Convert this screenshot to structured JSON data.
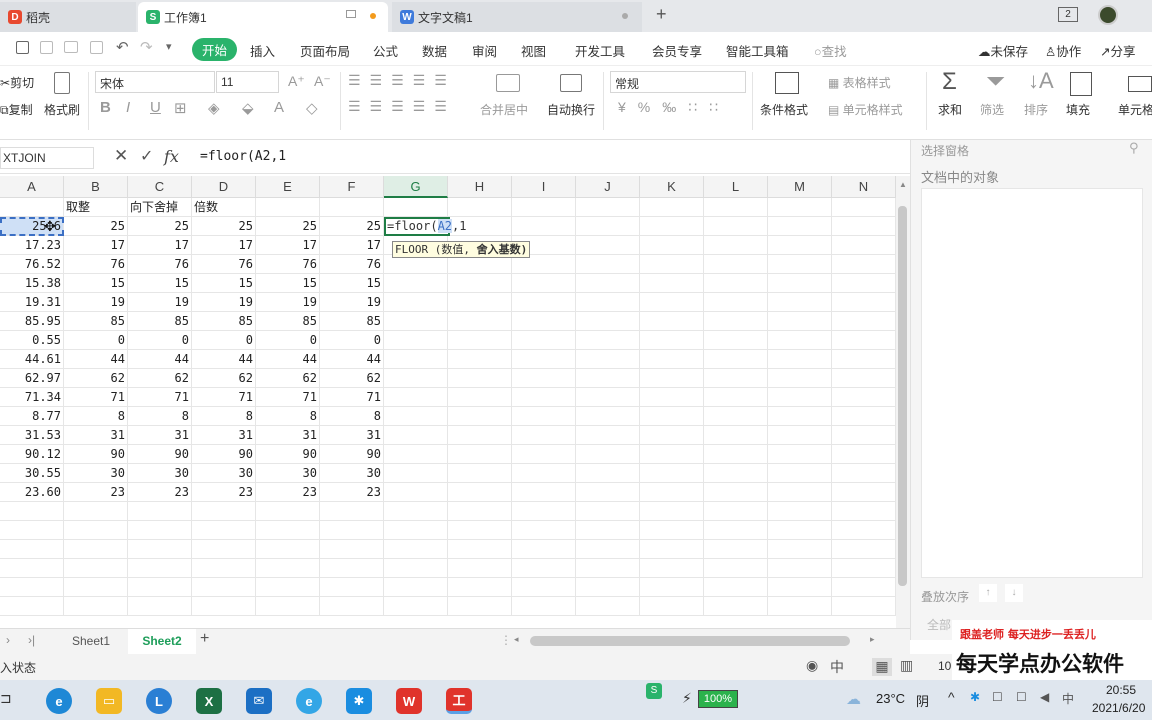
{
  "tabs": [
    {
      "label": "稻壳"
    },
    {
      "label": "工作簿1"
    },
    {
      "label": "文字文稿1"
    }
  ],
  "window": {
    "page_count": "2"
  },
  "menu": {
    "items": [
      "开始",
      "插入",
      "页面布局",
      "公式",
      "数据",
      "审阅",
      "视图",
      "开发工具",
      "会员专享",
      "智能工具箱"
    ],
    "search": "查找",
    "unsaved": "未保存",
    "collab": "协作",
    "share": "分享"
  },
  "ribbon": {
    "cut": "剪切",
    "format_painter": "格式刷",
    "copy": "复制",
    "font_name": "宋体",
    "font_size": "11",
    "merge": "合并居中",
    "wrap": "自动换行",
    "number_format": "常规",
    "cond_format": "条件格式",
    "table_style": "表格样式",
    "cell_style": "单元格样式",
    "sum": "求和",
    "filter": "筛选",
    "sort": "排序",
    "fill": "填充",
    "cell": "单元格"
  },
  "formula_bar": {
    "name_box": "XTJOIN",
    "fx": "fx",
    "formula": "=floor(A2,1"
  },
  "grid": {
    "columns": [
      "A",
      "B",
      "C",
      "D",
      "E",
      "F",
      "G",
      "H",
      "I",
      "J",
      "K",
      "L",
      "M",
      "N"
    ],
    "header_row": [
      "",
      "取整",
      "向下舍掉",
      "倍数",
      "",
      "",
      "",
      "",
      "",
      "",
      "",
      "",
      "",
      ""
    ],
    "rows": [
      [
        "25.6",
        "25",
        "25",
        "25",
        "25",
        "25"
      ],
      [
        "17.23",
        "17",
        "17",
        "17",
        "17",
        "17"
      ],
      [
        "76.52",
        "76",
        "76",
        "76",
        "76",
        "76"
      ],
      [
        "15.38",
        "15",
        "15",
        "15",
        "15",
        "15"
      ],
      [
        "19.31",
        "19",
        "19",
        "19",
        "19",
        "19"
      ],
      [
        "85.95",
        "85",
        "85",
        "85",
        "85",
        "85"
      ],
      [
        "0.55",
        "0",
        "0",
        "0",
        "0",
        "0"
      ],
      [
        "44.61",
        "44",
        "44",
        "44",
        "44",
        "44"
      ],
      [
        "62.97",
        "62",
        "62",
        "62",
        "62",
        "62"
      ],
      [
        "71.34",
        "71",
        "71",
        "71",
        "71",
        "71"
      ],
      [
        "8.77",
        "8",
        "8",
        "8",
        "8",
        "8"
      ],
      [
        "31.53",
        "31",
        "31",
        "31",
        "31",
        "31"
      ],
      [
        "90.12",
        "90",
        "90",
        "90",
        "90",
        "90"
      ],
      [
        "30.55",
        "30",
        "30",
        "30",
        "30",
        "30"
      ],
      [
        "23.60",
        "23",
        "23",
        "23",
        "23",
        "23"
      ]
    ],
    "edit_cell_prefix": "=floor(",
    "edit_cell_ref": "A2",
    "edit_cell_suffix": ",1",
    "tooltip_func": "FLOOR (数值, ",
    "tooltip_arg": "舍入基数)"
  },
  "pane": {
    "title": "选择窗格",
    "objects": "文档中的对象",
    "order": "叠放次序",
    "all": "全部"
  },
  "sheets": [
    "Sheet1",
    "Sheet2"
  ],
  "status": {
    "mode": "入状态",
    "zoom": "10"
  },
  "watermark": {
    "line1": "跟盖老师  每天进步一丢丢儿",
    "line2": "每天学点办公软件"
  },
  "taskbar": {
    "battery": "100%",
    "temp": "23°C",
    "weather": "阴",
    "time": "20:55",
    "date": "2021/6/20"
  },
  "colors": {
    "accent": "#2ab36b",
    "selection": "#1e7d45",
    "tooltip_bg": "#fffde0"
  }
}
